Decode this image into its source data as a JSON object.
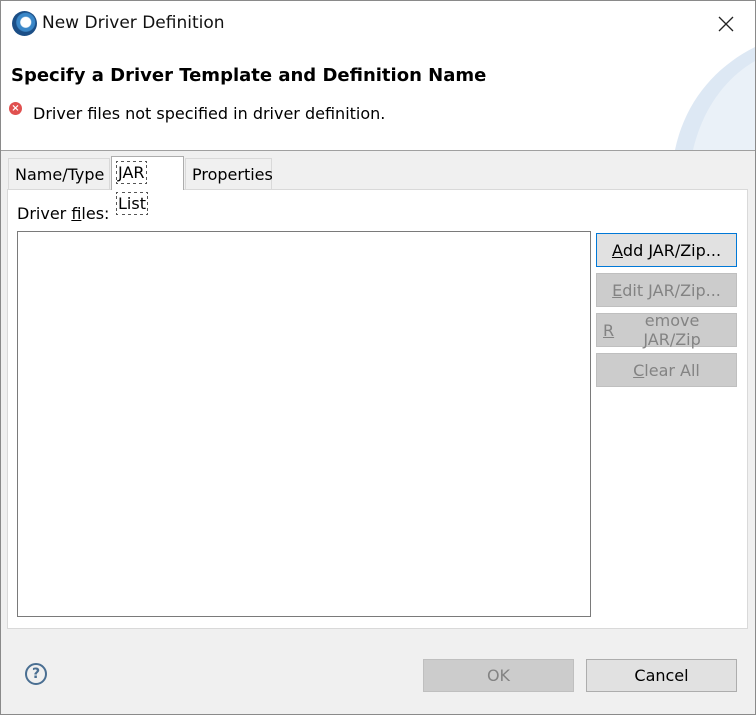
{
  "window": {
    "title": "New Driver Definition",
    "close_glyph": "✕",
    "icon": "app-icon"
  },
  "header": {
    "heading": "Specify a Driver Template and Definition Name",
    "message": "Driver files not specified in driver definition.",
    "message_icon": "error-icon",
    "message_icon_glyph": "×"
  },
  "tabs": [
    {
      "label": "Name/Type",
      "active": false
    },
    {
      "label": "JAR List",
      "active": true
    },
    {
      "label": "Properties",
      "active": false
    }
  ],
  "jar_list": {
    "label_prefix": "Driver ",
    "label_mnemonic": "f",
    "label_suffix": "iles:",
    "files": []
  },
  "buttons": {
    "add": {
      "mnemonic": "A",
      "rest": "dd JAR/Zip...",
      "enabled": true
    },
    "edit": {
      "mnemonic": "E",
      "rest": "dit JAR/Zip...",
      "enabled": false
    },
    "remove": {
      "mnemonic": "R",
      "rest": "emove JAR/Zip",
      "enabled": false
    },
    "clear": {
      "mnemonic": "C",
      "rest": "lear All",
      "enabled": false
    }
  },
  "footer": {
    "help_glyph": "?",
    "ok_label": "OK",
    "ok_enabled": false,
    "cancel_label": "Cancel"
  },
  "colors": {
    "accent": "#0078d7",
    "error": "#e0504f",
    "disabled_text": "#838383"
  }
}
